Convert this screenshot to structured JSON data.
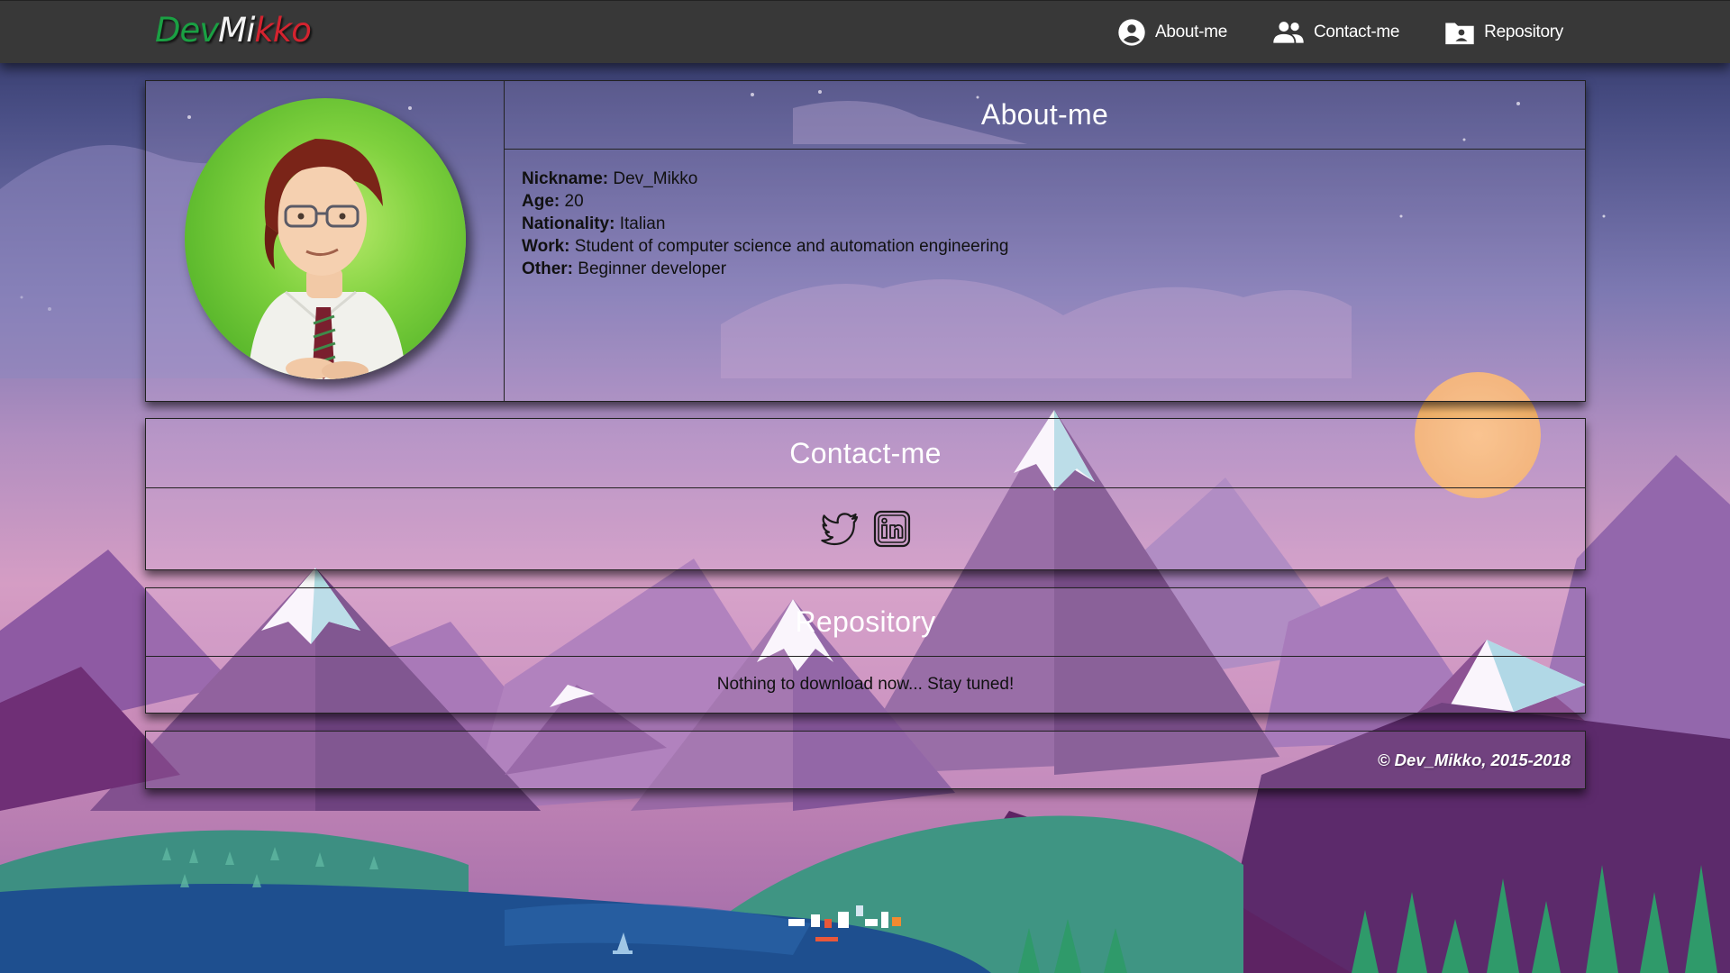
{
  "brand": {
    "part1": "Dev",
    "part2": "Mi",
    "part3": "kko",
    "colors": {
      "green": "#1aa043",
      "white": "#f2f2f2",
      "red": "#d4232f"
    }
  },
  "nav": {
    "items": [
      {
        "label": "About-me",
        "icon": "account-circle-icon"
      },
      {
        "label": "Contact-me",
        "icon": "people-icon"
      },
      {
        "label": "Repository",
        "icon": "folder-user-icon"
      }
    ]
  },
  "about": {
    "title": "About-me",
    "fields": [
      {
        "key": "Nickname:",
        "value": "Dev_Mikko"
      },
      {
        "key": "Age:",
        "value": "20"
      },
      {
        "key": "Nationality:",
        "value": "Italian"
      },
      {
        "key": "Work:",
        "value": "Student of computer science and automation engineering"
      },
      {
        "key": "Other:",
        "value": "Beginner developer"
      }
    ],
    "avatar_icon": "avatar-character-icon"
  },
  "contact": {
    "title": "Contact-me",
    "links": [
      {
        "icon": "twitter-icon"
      },
      {
        "icon": "linkedin-icon"
      }
    ]
  },
  "repository": {
    "title": "Repository",
    "message": "Nothing to download now... Stay tuned!"
  },
  "footer": {
    "copyright": "© Dev_Mikko, 2015-2018"
  },
  "theme": {
    "navbar_bg": "#383838",
    "panel_border": "#222222",
    "avatar_green": "#7fd13e"
  }
}
